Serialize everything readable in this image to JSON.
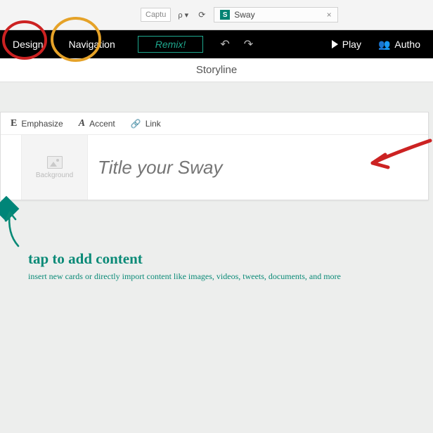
{
  "browser": {
    "search_placeholder": "Captu",
    "search_suffix": "ρ ▾",
    "refresh_icon": "⟳",
    "tab_label": "Sway",
    "tab_close": "×"
  },
  "toolbar": {
    "design": "Design",
    "navigation": "Navigation",
    "remix": "Remix!",
    "play": "Play",
    "authors": "Autho"
  },
  "subheader": "Storyline",
  "format": {
    "emphasize": "Emphasize",
    "accent": "Accent",
    "link": "Link"
  },
  "card": {
    "bg_tile": "Background",
    "title_placeholder": "Title your Sway"
  },
  "annotation": {
    "main": "tap to add content",
    "sub": "insert new cards or directly import content like images, videos, tweets, documents, and more"
  }
}
